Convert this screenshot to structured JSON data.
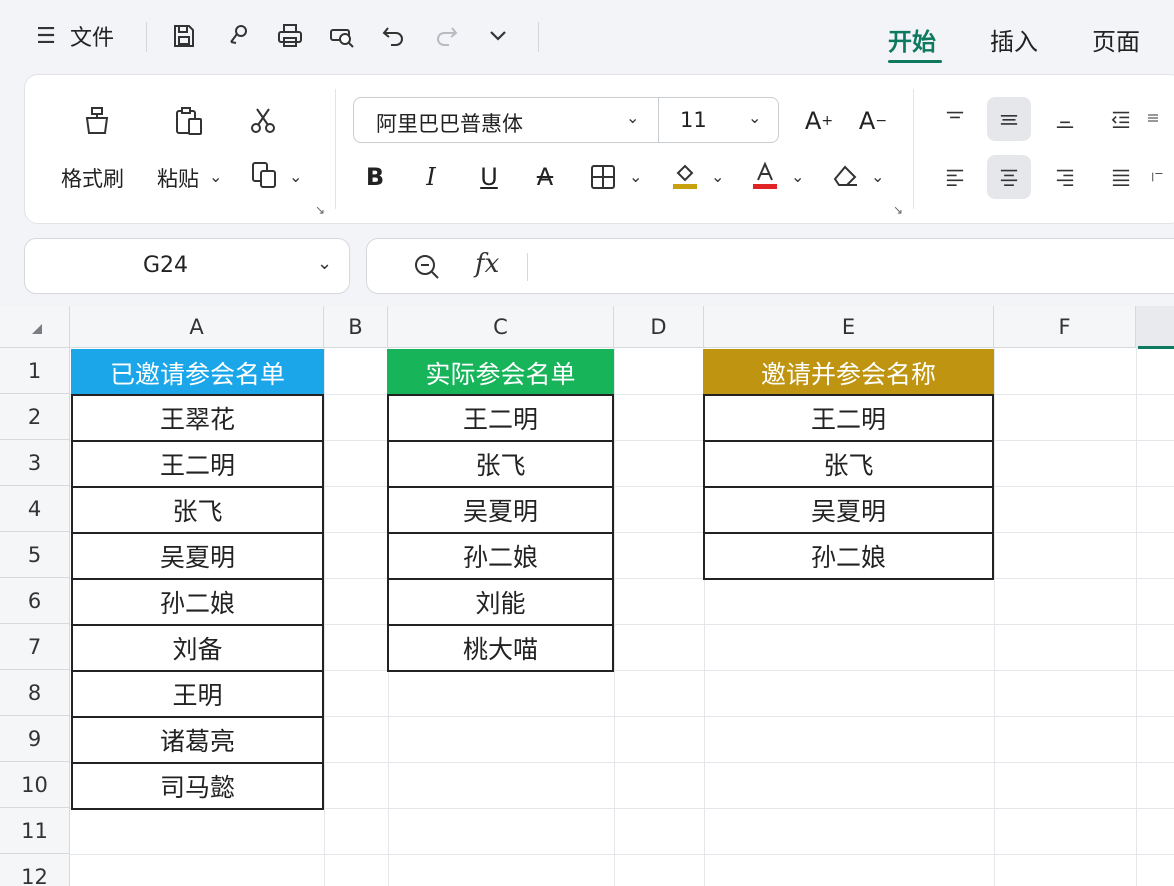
{
  "titlebar": {
    "file_label": "文件",
    "tabs": [
      {
        "label": "开始",
        "active": true
      },
      {
        "label": "插入",
        "active": false
      },
      {
        "label": "页面",
        "active": false
      }
    ]
  },
  "ribbon": {
    "format_painter_label": "格式刷",
    "paste_label": "粘贴",
    "font_name": "阿里巴巴普惠体",
    "font_size": "11"
  },
  "formula_bar": {
    "cell_reference": "G24",
    "fx_label": "fx",
    "formula": ""
  },
  "sheet": {
    "columns": [
      "A",
      "B",
      "C",
      "D",
      "E",
      "F"
    ],
    "rows": [
      "1",
      "2",
      "3",
      "4",
      "5",
      "6",
      "7",
      "8",
      "9",
      "10",
      "11",
      "12"
    ],
    "table_a": {
      "header": "已邀请参会名单",
      "header_color": "#1aa6e8",
      "names": [
        "王翠花",
        "王二明",
        "张飞",
        "吴夏明",
        "孙二娘",
        "刘备",
        "王明",
        "诸葛亮",
        "司马懿"
      ]
    },
    "table_c": {
      "header": "实际参会名单",
      "header_color": "#17b45a",
      "names": [
        "王二明",
        "张飞",
        "吴夏明",
        "孙二娘",
        "刘能",
        "桃大喵"
      ]
    },
    "table_e": {
      "header": "邀请并参会名称",
      "header_color": "#bf9410",
      "names": [
        "王二明",
        "张飞",
        "吴夏明",
        "孙二娘"
      ]
    }
  },
  "colors": {
    "accent": "#0d7a5f",
    "font_color_bar": "#e02424",
    "fill_color_bar": "#c9a10f"
  }
}
